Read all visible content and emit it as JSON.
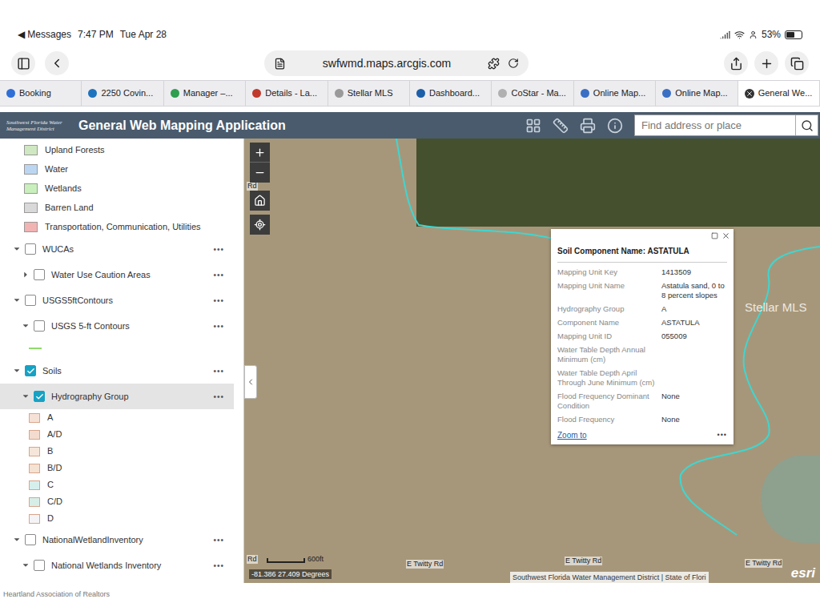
{
  "status_bar": {
    "back": "◀ Messages",
    "time": "7:47 PM",
    "date": "Tue Apr 28",
    "battery": "53%",
    "battery_level": 0.53
  },
  "browser": {
    "url": "swfwmd.maps.arcgis.com",
    "tabs": [
      {
        "label": "Booking",
        "selected": false,
        "color": "#2f6fd6"
      },
      {
        "label": "2250 Covin...",
        "selected": false,
        "color": "#1e73be"
      },
      {
        "label": "Manager –...",
        "selected": false,
        "color": "#2e9e4f"
      },
      {
        "label": "Details - La...",
        "selected": false,
        "color": "#c0392b"
      },
      {
        "label": "Stellar MLS",
        "selected": false,
        "color": "#9a9a9a"
      },
      {
        "label": "Dashboard...",
        "selected": false,
        "color": "#1d5fa8"
      },
      {
        "label": "CoStar - Ma...",
        "selected": false,
        "color": "#b0b0b0"
      },
      {
        "label": "Online Map...",
        "selected": false,
        "color": "#3b6fc4"
      },
      {
        "label": "Online Map...",
        "selected": false,
        "color": "#3b6fc4"
      },
      {
        "label": "General We...",
        "selected": true,
        "color": "#333333"
      }
    ]
  },
  "app": {
    "logo": "Southwest Florida Water Management District",
    "title": "General Web Mapping Application",
    "search": {
      "placeholder": "Find address or place"
    }
  },
  "layer_list": {
    "menu": "•••",
    "rows": [
      {
        "kind": "legend",
        "label": "Upland Forests",
        "color": "#cfe8c2"
      },
      {
        "kind": "legend",
        "label": "Water",
        "color": "#bcd6f2"
      },
      {
        "kind": "legend",
        "label": "Wetlands",
        "color": "#c9efbd"
      },
      {
        "kind": "legend",
        "label": "Barren Land",
        "color": "#d9d9d9"
      },
      {
        "kind": "legend",
        "label": "Transportation, Communication, Utilities",
        "color": "#f2b3b3"
      },
      {
        "kind": "layer",
        "label": "WUCAs",
        "checked": false,
        "expanded": true,
        "selected": false
      },
      {
        "kind": "sublayer",
        "label": "Water Use Caution Areas",
        "checked": false,
        "expanded": false,
        "selected": false
      },
      {
        "kind": "layer",
        "label": "USGS5ftContours",
        "checked": false,
        "expanded": true,
        "selected": false
      },
      {
        "kind": "sublayer",
        "label": "USGS 5-ft Contours",
        "checked": false,
        "expanded": true,
        "selected": false
      },
      {
        "kind": "line",
        "color": "#8fdc6a"
      },
      {
        "kind": "layer",
        "label": "Soils",
        "checked": true,
        "expanded": true,
        "selected": false
      },
      {
        "kind": "sublayer",
        "label": "Hydrography Group",
        "checked": true,
        "expanded": true,
        "selected": true
      },
      {
        "kind": "swatch",
        "label": "A",
        "color": "#f6e1d6"
      },
      {
        "kind": "swatch",
        "label": "A/D",
        "color": "#f3dccf"
      },
      {
        "kind": "swatch",
        "label": "B",
        "color": "#f6e6d9"
      },
      {
        "kind": "swatch",
        "label": "B/D",
        "color": "#f4e2d2"
      },
      {
        "kind": "swatch",
        "label": "C",
        "color": "#d7efec"
      },
      {
        "kind": "swatch",
        "label": "C/D",
        "color": "#d6eee6"
      },
      {
        "kind": "swatch",
        "label": "D",
        "color": "#f4f4f6"
      },
      {
        "kind": "layer",
        "label": "NationalWetlandInventory",
        "checked": false,
        "expanded": true,
        "selected": false
      },
      {
        "kind": "sublayer",
        "label": "National Wetlands Inventory",
        "checked": false,
        "expanded": true,
        "selected": false
      }
    ]
  },
  "map": {
    "road_labels": [
      "Rd",
      "E Twitty Rd",
      "E Twitty Rd",
      "E Twitty Rd",
      "Rd"
    ],
    "watermark": "Stellar MLS",
    "scale": "600ft",
    "coordinates": "-81.386 27.409 Degrees",
    "attribution": "Southwest Florida Water Management District | State of Flori",
    "logo": "esri",
    "popup": {
      "title": "Soil Component Name: ASTATULA",
      "fields": [
        {
          "label": "Mapping Unit Key",
          "value": "1413509"
        },
        {
          "label": "Mapping Unit Name",
          "value": "Astatula sand, 0 to 8 percent slopes"
        },
        {
          "label": "Hydrography Group",
          "value": "A"
        },
        {
          "label": "Component Name",
          "value": "ASTATULA"
        },
        {
          "label": "Mapping Unit ID",
          "value": "055009"
        },
        {
          "label": "Water Table Depth Annual Minimum (cm)",
          "value": ""
        },
        {
          "label": "Water Table Depth April Through June Minimum (cm)",
          "value": ""
        },
        {
          "label": "Flood Frequency Dominant Condition",
          "value": "None"
        },
        {
          "label": "Flood Frequency",
          "value": "None"
        }
      ],
      "zoom": "Zoom to",
      "menu": "•••"
    }
  },
  "footer": {
    "watermark": "Heartland Association of Realtors"
  }
}
